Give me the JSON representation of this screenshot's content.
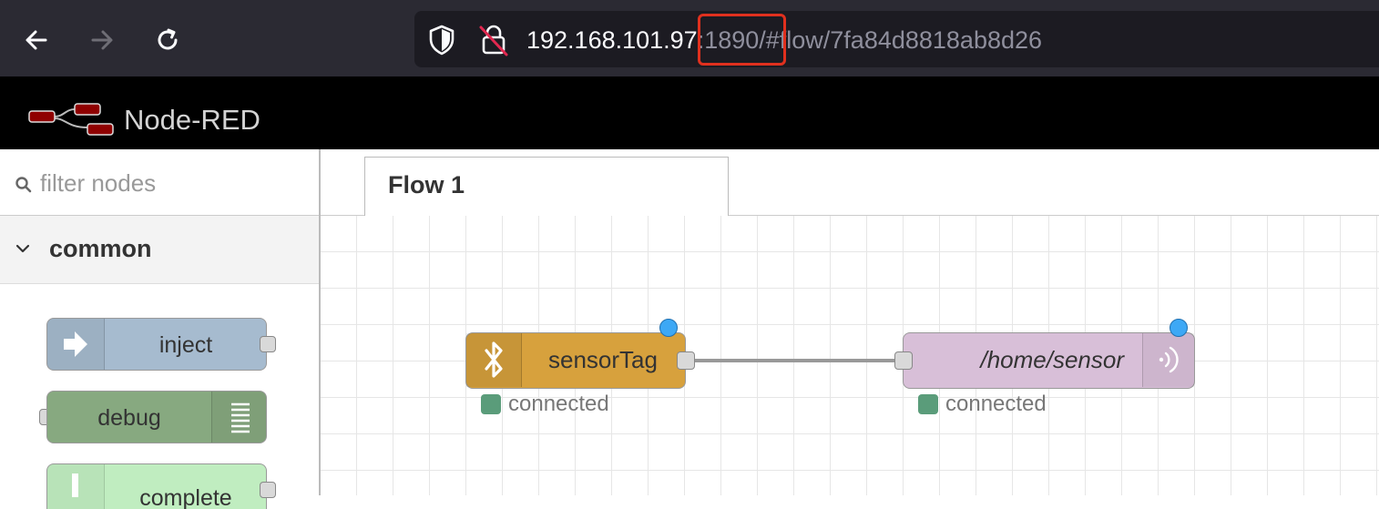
{
  "browser": {
    "url_host": "192.168.101.97",
    "url_rest": ":1890/#flow/7fa84d8818ab8d26"
  },
  "app": {
    "title": "Node-RED"
  },
  "palette": {
    "filter_placeholder": "filter nodes",
    "category": "common",
    "nodes": [
      {
        "label": "inject",
        "color": "#a6bbcf"
      },
      {
        "label": "debug",
        "color": "#87a980"
      },
      {
        "label": "complete",
        "color": "#c0edc0"
      }
    ]
  },
  "workspace": {
    "tabs": [
      {
        "label": "Flow 1"
      }
    ],
    "nodes": [
      {
        "label": "sensorTag",
        "color": "#d7a13d",
        "status": "connected",
        "status_color": "#5a9c7a",
        "icon": "bluetooth-icon"
      },
      {
        "label": "/home/sensor",
        "color": "#d8bfd8",
        "status": "connected",
        "status_color": "#5a9c7a",
        "icon": "mqtt-broadcast-icon"
      }
    ]
  },
  "colors": {
    "highlight": "#e0301e",
    "changed_indicator": "#3da8f5"
  }
}
